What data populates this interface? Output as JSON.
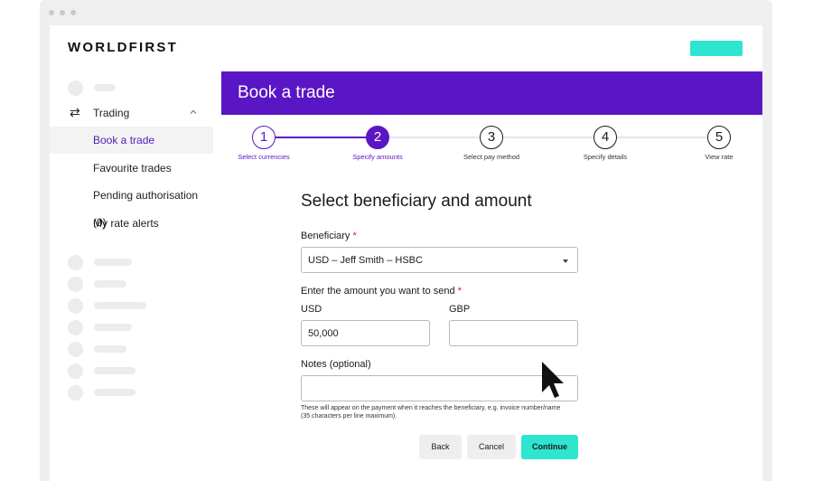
{
  "brand": {
    "name": "WORLDFIRST"
  },
  "header": {
    "action_color": "#2ee5d0"
  },
  "sidebar": {
    "trading": {
      "label": "Trading",
      "icon": "swap-arrows-icon",
      "expanded": true
    },
    "items": [
      {
        "label": "Book a trade",
        "active": true
      },
      {
        "label": "Favourite trades",
        "active": false
      },
      {
        "label": "Pending authorisation (0)",
        "active": false
      },
      {
        "label": "My rate alerts",
        "active": false
      }
    ]
  },
  "banner": {
    "title": "Book a trade",
    "color": "#5a16c4"
  },
  "stepper": {
    "current": 2,
    "steps": [
      {
        "number": "1",
        "label": "Select currencies"
      },
      {
        "number": "2",
        "label": "Specify amounts"
      },
      {
        "number": "3",
        "label": "Select pay method"
      },
      {
        "number": "4",
        "label": "Specify details"
      },
      {
        "number": "5",
        "label": "View rate"
      }
    ]
  },
  "form": {
    "title": "Select beneficiary and amount",
    "beneficiary": {
      "label": "Beneficiary",
      "required_mark": "*",
      "value": "USD – Jeff Smith – HSBC"
    },
    "amount": {
      "label": "Enter the amount you want to send",
      "required_mark": "*",
      "from": {
        "currency": "USD",
        "value": "50,000"
      },
      "to": {
        "currency": "GBP",
        "value": ""
      }
    },
    "notes": {
      "label": "Notes (optional)",
      "value": "",
      "helper": "These will appear on the payment when it reaches the beneficiary, e.g. invoice number/name (35 characters per line maximum)."
    }
  },
  "actions": {
    "back": "Back",
    "cancel": "Cancel",
    "continue": "Continue"
  }
}
